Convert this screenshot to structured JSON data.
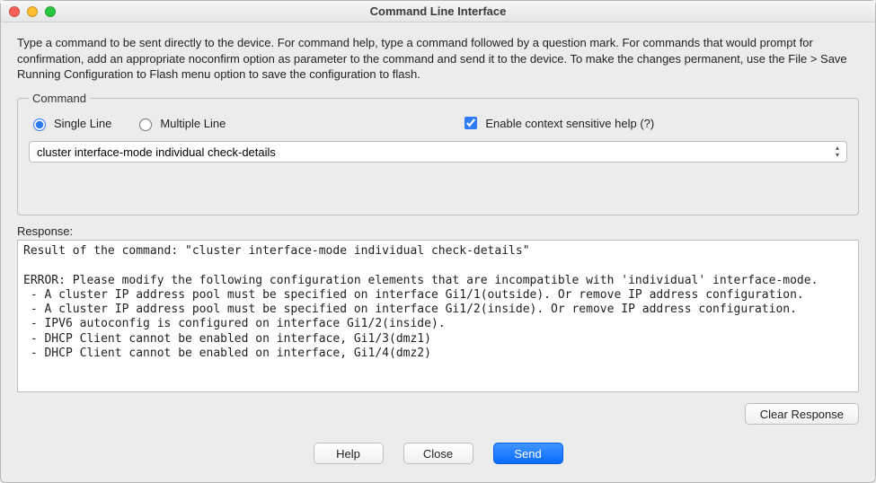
{
  "window": {
    "title": "Command Line Interface"
  },
  "instructions": "Type a command to be sent directly to the device. For command help, type a command followed by a question mark. For commands that would prompt for confirmation, add an appropriate noconfirm option as parameter to the command and send it to the device. To make the changes permanent, use the File > Save Running Configuration to Flash menu option to save the configuration to flash.",
  "command": {
    "legend": "Command",
    "mode_single_label": "Single Line",
    "mode_multiple_label": "Multiple Line",
    "mode_selected": "single",
    "help_checkbox_label": "Enable context sensitive help (?)",
    "help_checked": true,
    "input_value": "cluster interface-mode individual check-details"
  },
  "response": {
    "label": "Response:",
    "text": "Result of the command: \"cluster interface-mode individual check-details\"\n\nERROR: Please modify the following configuration elements that are incompatible with 'individual' interface-mode.\n - A cluster IP address pool must be specified on interface Gi1/1(outside). Or remove IP address configuration.\n - A cluster IP address pool must be specified on interface Gi1/2(inside). Or remove IP address configuration.\n - IPV6 autoconfig is configured on interface Gi1/2(inside).\n - DHCP Client cannot be enabled on interface, Gi1/3(dmz1)\n - DHCP Client cannot be enabled on interface, Gi1/4(dmz2)"
  },
  "buttons": {
    "clear": "Clear Response",
    "help": "Help",
    "close": "Close",
    "send": "Send"
  }
}
